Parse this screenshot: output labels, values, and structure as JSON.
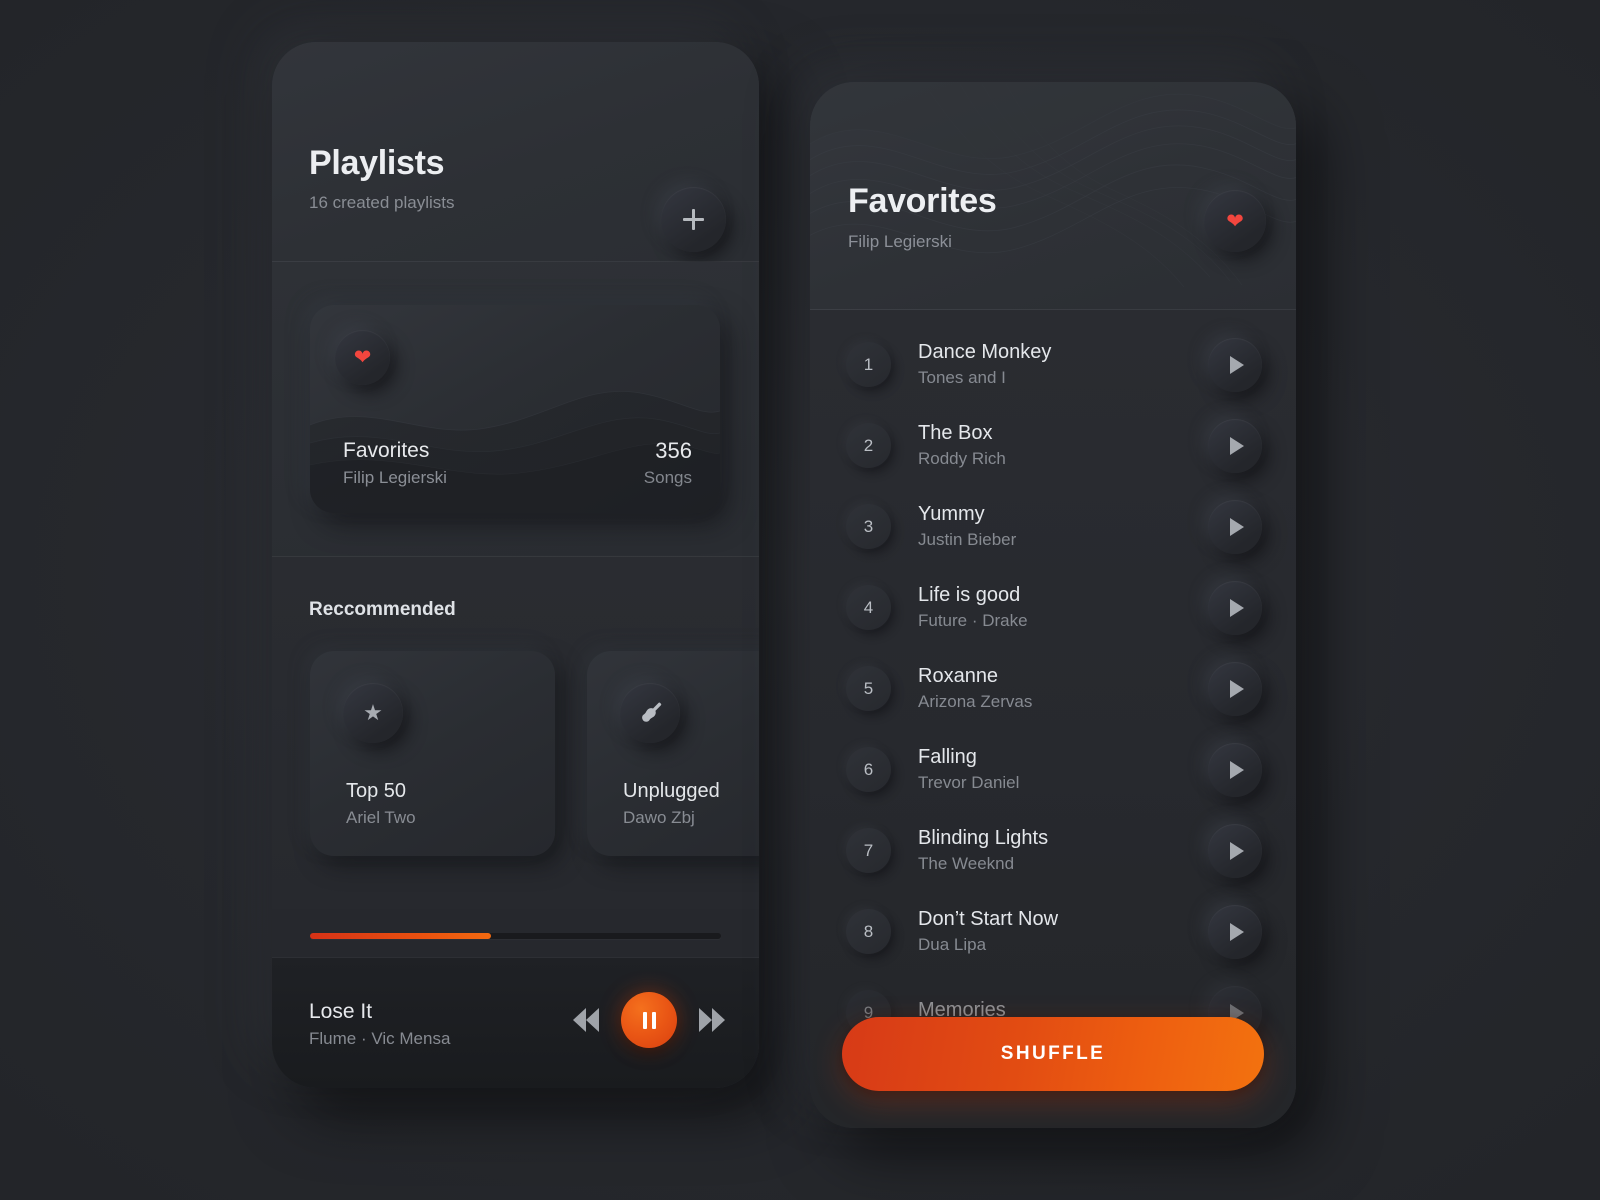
{
  "playlists_screen": {
    "header": {
      "title": "Playlists",
      "subtitle": "16 created playlists",
      "add_button_label": "+"
    },
    "favorites_card": {
      "name": "Favorites",
      "owner": "Filip Legierski",
      "count": "356",
      "count_label": "Songs",
      "icon": "heart-icon"
    },
    "recommended": {
      "section_title": "Reccommended",
      "cards": [
        {
          "name": "Top 50",
          "artist": "Ariel Two",
          "icon": "star-icon"
        },
        {
          "name": "Unplugged",
          "artist": "Dawo Zbj",
          "icon": "guitar-icon"
        }
      ]
    },
    "player": {
      "song": "Lose It",
      "artist": "Flume · Vic Mensa",
      "progress_percent": 44,
      "prev_icon": "rewind-icon",
      "play_icon": "pause-icon",
      "next_icon": "fast-forward-icon"
    }
  },
  "favorites_screen": {
    "header": {
      "title": "Favorites",
      "subtitle": "Filip Legierski",
      "icon": "heart-icon"
    },
    "tracks": [
      {
        "num": "1",
        "title": "Dance Monkey",
        "artist": "Tones and I"
      },
      {
        "num": "2",
        "title": "The Box",
        "artist": "Roddy Rich"
      },
      {
        "num": "3",
        "title": "Yummy",
        "artist": "Justin Bieber"
      },
      {
        "num": "4",
        "title": "Life is good",
        "artist": "Future · Drake"
      },
      {
        "num": "5",
        "title": "Roxanne",
        "artist": "Arizona Zervas"
      },
      {
        "num": "6",
        "title": "Falling",
        "artist": "Trevor Daniel"
      },
      {
        "num": "7",
        "title": "Blinding Lights",
        "artist": "The Weeknd"
      },
      {
        "num": "8",
        "title": "Don’t Start Now",
        "artist": "Dua Lipa"
      },
      {
        "num": "9",
        "title": "Memories",
        "artist": ""
      }
    ],
    "shuffle_label": "SHUFFLE"
  },
  "colors": {
    "background": "#27292e",
    "surface": "#2b2d32",
    "accent_orange": "#ea5715",
    "accent_red": "#d73a17",
    "heart_red": "#f2463e",
    "text_primary": "#e6e8ec",
    "text_secondary": "#888c93"
  }
}
